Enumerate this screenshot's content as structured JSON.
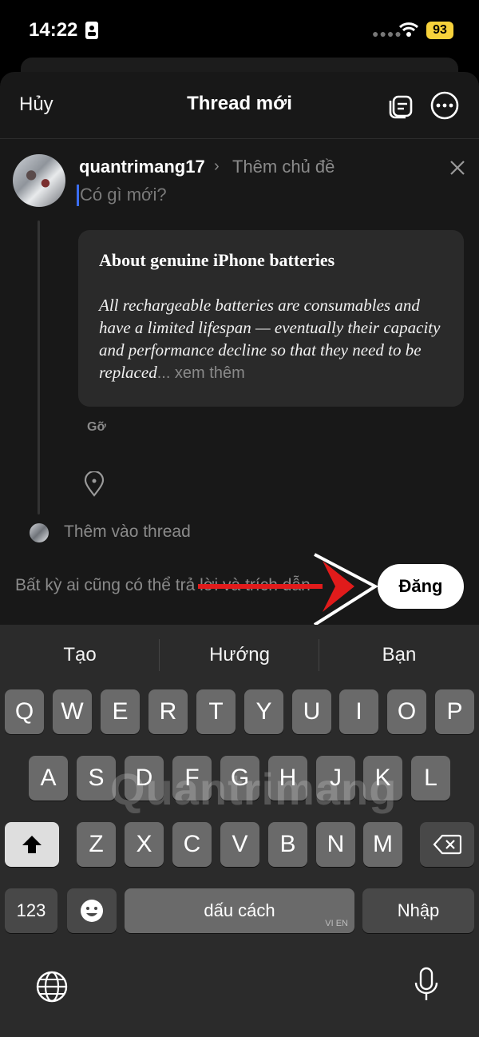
{
  "status_bar": {
    "time": "14:22",
    "battery": "93"
  },
  "header": {
    "cancel_label": "Hủy",
    "title": "Thread mới"
  },
  "compose": {
    "username": "quantrimang17",
    "topic_placeholder": "Thêm chủ đề",
    "text_placeholder": "Có gì mới?",
    "card_title": "About genuine iPhone batteries",
    "card_body": "All rechargeable batteries are consumables and have a limited lifespan — eventually their capacity and performance decline so that they need to be replaced",
    "card_more": "... xem thêm",
    "remove_label": "Gỡ",
    "add_thread_label": "Thêm vào thread",
    "reply_permission": "Bất kỳ ai cũng có thể trả lời và trích dẫn",
    "post_label": "Đăng"
  },
  "keyboard": {
    "suggestions": [
      "Tạo",
      "Hướng",
      "Bạn"
    ],
    "row1": [
      "Q",
      "W",
      "E",
      "R",
      "T",
      "Y",
      "U",
      "I",
      "O",
      "P"
    ],
    "row2": [
      "A",
      "S",
      "D",
      "F",
      "G",
      "H",
      "J",
      "K",
      "L"
    ],
    "row3": [
      "Z",
      "X",
      "C",
      "V",
      "B",
      "N",
      "M"
    ],
    "numbers_label": "123",
    "space_label": "dấu cách",
    "space_lang": "VI EN",
    "enter_label": "Nhập"
  },
  "watermark": "Quantrimang",
  "colors": {
    "accent": "#3b6ef5",
    "battery": "#f7d23b",
    "arrow": "#e11b1b"
  },
  "icons": [
    "wifi-icon",
    "portrait-lock-icon",
    "drafts-icon",
    "more-icon",
    "close-icon",
    "chevron-right-icon",
    "location-pin-icon",
    "shift-icon",
    "backspace-icon",
    "emoji-icon",
    "globe-icon",
    "microphone-icon"
  ]
}
